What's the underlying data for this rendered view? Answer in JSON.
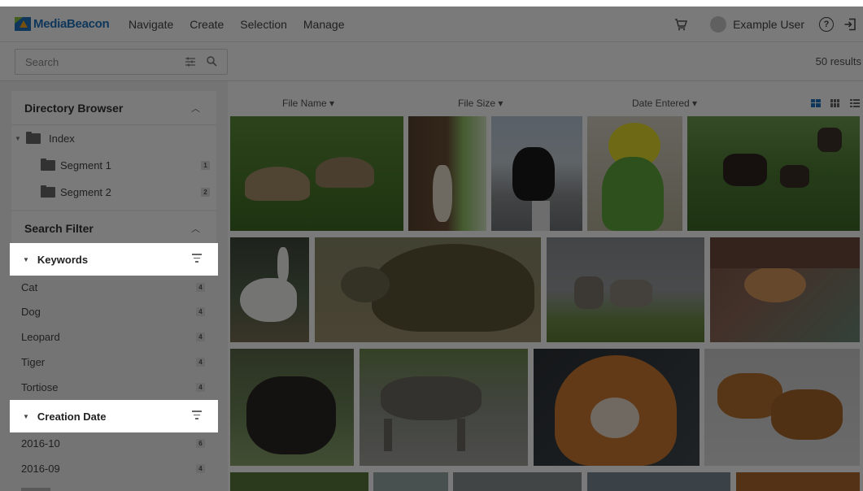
{
  "app": {
    "brand": "MediaBeacon",
    "nav": [
      "Navigate",
      "Create",
      "Selection",
      "Manage"
    ],
    "user_name": "Example User",
    "cart_icon": "cart-icon",
    "help_icon": "help-icon",
    "logout_icon": "logout-icon"
  },
  "search": {
    "placeholder": "Search",
    "results": "50 results"
  },
  "directory": {
    "title": "Directory Browser",
    "root": "Index",
    "children": [
      {
        "label": "Segment 1",
        "count": "1"
      },
      {
        "label": "Segment 2",
        "count": "2"
      }
    ]
  },
  "search_filter": {
    "title": "Search Filter",
    "keywords": {
      "label": "Keywords",
      "items": [
        {
          "label": "Cat",
          "count": "4"
        },
        {
          "label": "Dog",
          "count": "4"
        },
        {
          "label": "Leopard",
          "count": "4"
        },
        {
          "label": "Tiger",
          "count": "4"
        },
        {
          "label": "Tortiose",
          "count": "4"
        }
      ]
    },
    "creation_date": {
      "label": "Creation Date",
      "items": [
        {
          "label": "2016-10",
          "count": "6"
        },
        {
          "label": "2016-09",
          "count": "4"
        }
      ]
    }
  },
  "results_header": {
    "sort_file_name": "File Name ▾",
    "sort_file_size": "File Size ▾",
    "sort_date_entered": "Date Entered ▾"
  },
  "thumbnails": [
    "tortoises on grass",
    "squirrel on tree",
    "black cat on fence",
    "green budgie",
    "moose in forest",
    "white goose",
    "large tortoise",
    "wolves on rock",
    "dog under blanket",
    "yak lying down",
    "tabby cat walking",
    "tiger close-up",
    "tigers in snow"
  ],
  "colors": {
    "brand_blue": "#1e73be",
    "overlay": "rgba(0,0,0,0.52)"
  }
}
